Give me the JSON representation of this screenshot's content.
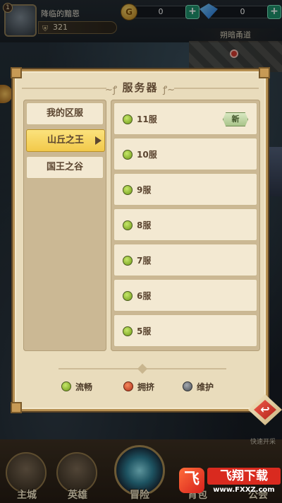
{
  "game_ui": {
    "player": {
      "name": "降临的黯恩",
      "level": "1",
      "power": "321"
    },
    "currency": {
      "gold": {
        "icon": "G",
        "value": "0"
      },
      "gems": {
        "value": "0"
      },
      "plus": "+"
    },
    "map": {
      "banner": "朔暗甬道"
    },
    "quick_explore": "快速开采",
    "bottom_nav": [
      "主城",
      "英雄",
      "冒险",
      "背包",
      "公会"
    ]
  },
  "modal": {
    "title": "服务器",
    "regions": [
      {
        "label": "我的区服",
        "active": false
      },
      {
        "label": "山丘之王",
        "active": true
      },
      {
        "label": "国王之谷",
        "active": false
      }
    ],
    "servers": [
      {
        "name": "11服",
        "status": "smooth",
        "badge": "新"
      },
      {
        "name": "10服",
        "status": "smooth"
      },
      {
        "name": "9服",
        "status": "smooth"
      },
      {
        "name": "8服",
        "status": "smooth"
      },
      {
        "name": "7服",
        "status": "smooth"
      },
      {
        "name": "6服",
        "status": "smooth"
      },
      {
        "name": "5服",
        "status": "smooth"
      }
    ],
    "legend": [
      {
        "label": "流畅",
        "color": "#8fbf2f"
      },
      {
        "label": "拥挤",
        "color": "#e0532c"
      },
      {
        "label": "维护",
        "color": "#6d7278"
      }
    ]
  },
  "watermark": {
    "brand": "飞翔下载",
    "url": "www.FXXZ.com",
    "icon": "飞"
  },
  "colors": {
    "smooth": "#8fbf2f",
    "crowded": "#e0532c",
    "maintenance": "#6d7278"
  }
}
